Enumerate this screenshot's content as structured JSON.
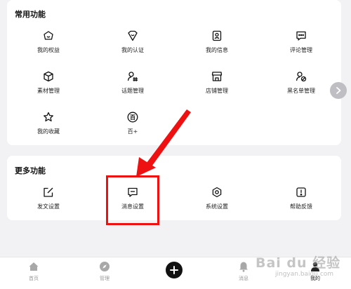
{
  "common": {
    "title": "常用功能",
    "items": [
      {
        "label": "我的权益",
        "icon": "shop-bag-icon"
      },
      {
        "label": "我的认证",
        "icon": "badge-heart-icon"
      },
      {
        "label": "我的信息",
        "icon": "id-card-icon"
      },
      {
        "label": "评论管理",
        "icon": "comment-icon"
      },
      {
        "label": "素材管理",
        "icon": "cube-icon"
      },
      {
        "label": "话题管理",
        "icon": "user-hash-icon"
      },
      {
        "label": "店铺管理",
        "icon": "store-icon"
      },
      {
        "label": "黑名单管理",
        "icon": "user-block-icon"
      },
      {
        "label": "我的收藏",
        "icon": "star-icon"
      },
      {
        "label": "百+",
        "icon": "circle-bai-icon",
        "glyph": "百"
      }
    ]
  },
  "more": {
    "title": "更多功能",
    "items": [
      {
        "label": "发文设置",
        "icon": "edit-icon"
      },
      {
        "label": "消息设置",
        "icon": "message-icon"
      },
      {
        "label": "系统设置",
        "icon": "gear-icon"
      },
      {
        "label": "帮助反馈",
        "icon": "help-icon"
      }
    ]
  },
  "tabbar": {
    "items": [
      {
        "label": "首页",
        "icon": "home-icon"
      },
      {
        "label": "管理",
        "icon": "compass-icon"
      },
      {
        "label": "",
        "icon": "plus-icon"
      },
      {
        "label": "消息",
        "icon": "bell-icon"
      },
      {
        "label": "我的",
        "icon": "user-icon"
      }
    ]
  },
  "watermark": {
    "text": "Bai du 经验",
    "sub": "jingyan.baidu.com"
  },
  "colors": {
    "accent_red": "#ee1111",
    "background": "#f2f2f4",
    "card": "#ffffff",
    "tab_inactive": "#9a9a9a"
  }
}
